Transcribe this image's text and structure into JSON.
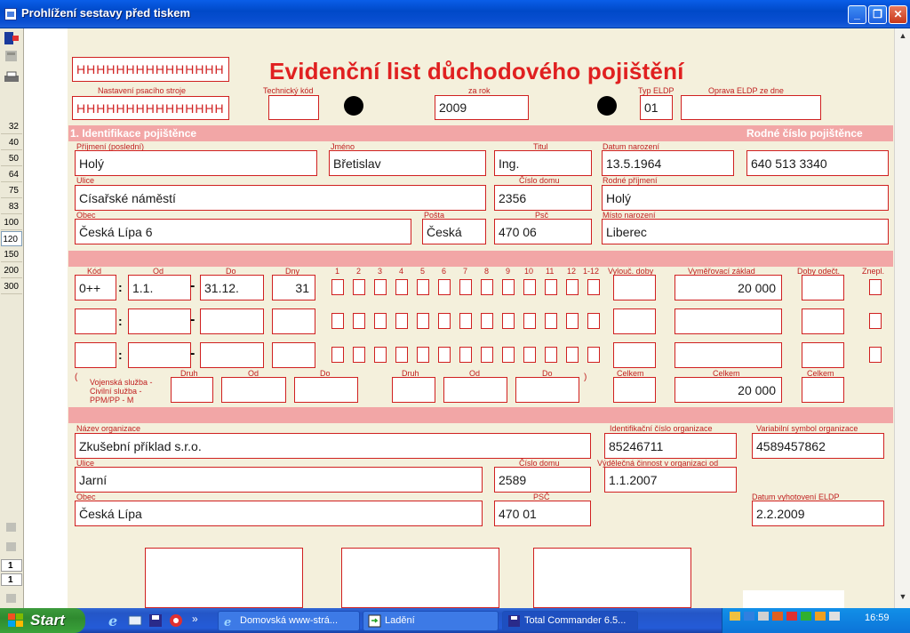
{
  "window": {
    "title": "Prohlížení sestavy před tiskem",
    "min": "_",
    "max": "❐",
    "close": "✕"
  },
  "toolbar": {
    "zoom_levels": [
      "32",
      "40",
      "50",
      "64",
      "75",
      "83",
      "100",
      "120",
      "150",
      "200",
      "300"
    ],
    "selected_zoom": "120",
    "pages": [
      "1",
      "1"
    ]
  },
  "form": {
    "title": "Evidenční list důchodového pojištění",
    "header": {
      "field1_value": "HHHHHHHHHHHHHHH",
      "typewriter_label": "Nastavení psacího stroje",
      "typewriter_value": "HHHHHHHHHHHHHHH",
      "tech_code_label": "Technický kód",
      "tech_code_value": "",
      "year_label": "za rok",
      "year_value": "2009",
      "type_label": "Typ ELDP",
      "type_value": "01",
      "correction_label": "Oprava ELDP ze dne",
      "correction_value": ""
    },
    "section1": {
      "title": "1. Identifikace pojištěnce",
      "rc_title": "Rodné číslo pojištěnce",
      "surname_label": "Příjmení (poslední)",
      "surname": "Holý",
      "name_label": "Jméno",
      "name": "Břetislav",
      "degree_label": "Titul",
      "degree": "Ing.",
      "birthdate_label": "Datum narození",
      "birthdate": "13.5.1964",
      "rc": "640 513 3340",
      "street_label": "Ulice",
      "street": "Císařské náměstí",
      "house_label": "Číslo domu",
      "house": "2356",
      "birthname_label": "Rodné příjmení",
      "birthname": "Holý",
      "city_label": "Obec",
      "city": "Česká Lípa 6",
      "post_label": "Pošta",
      "post": "Česká",
      "zip_label": "Psč",
      "zip": "470 06",
      "birthplace_label": "Místo narození",
      "birthplace": "Liberec"
    },
    "periods": {
      "code_label": "Kód",
      "from_label": "Od",
      "to_label": "Do",
      "days_label": "Dny",
      "months": [
        "1",
        "2",
        "3",
        "4",
        "5",
        "6",
        "7",
        "8",
        "9",
        "10",
        "11",
        "12",
        "1-12"
      ],
      "excluded_label": "Vylouč. doby",
      "base_label": "Vyměřovací základ",
      "deducted_label": "Doby odečt.",
      "disabled_label": "Znepl.",
      "row1": {
        "code": "0++",
        "from": "1.1.",
        "to": "31.12.",
        "days": "31",
        "base": "20 000"
      },
      "military1": "Vojenská služba -",
      "military2": "Civilní služba     -",
      "military3": "PPM/PP          - M",
      "kind_label": "Druh",
      "od_label": "Od",
      "do_label": "Do",
      "total_label": "Celkem",
      "total_base": "20 000",
      "paren_open": "(",
      "paren_close": ")"
    },
    "org": {
      "name_label": "Název organizace",
      "name": "Zkušební příklad s.r.o.",
      "id_label": "Identifikační číslo organizace",
      "id": "85246711",
      "vs_label": "Variabilní symbol organizace",
      "vs": "4589457862",
      "street_label": "Ulice",
      "street": "Jarní",
      "house_label": "Číslo domu",
      "house": "2589",
      "activity_label": "Výdělečná činnost v organizaci od",
      "activity": "1.1.2007",
      "city_label": "Obec",
      "city": "Česká Lípa",
      "zip_label": "PSČ",
      "zip": "470 01",
      "issued_label": "Datum vyhotovení ELDP",
      "issued": "2.2.2009"
    }
  },
  "taskbar": {
    "start": "Start",
    "expand": "»",
    "tasks": [
      "Domovská www-strá...",
      "Ladění",
      "Total Commander 6.5..."
    ],
    "clock": "16:59"
  }
}
